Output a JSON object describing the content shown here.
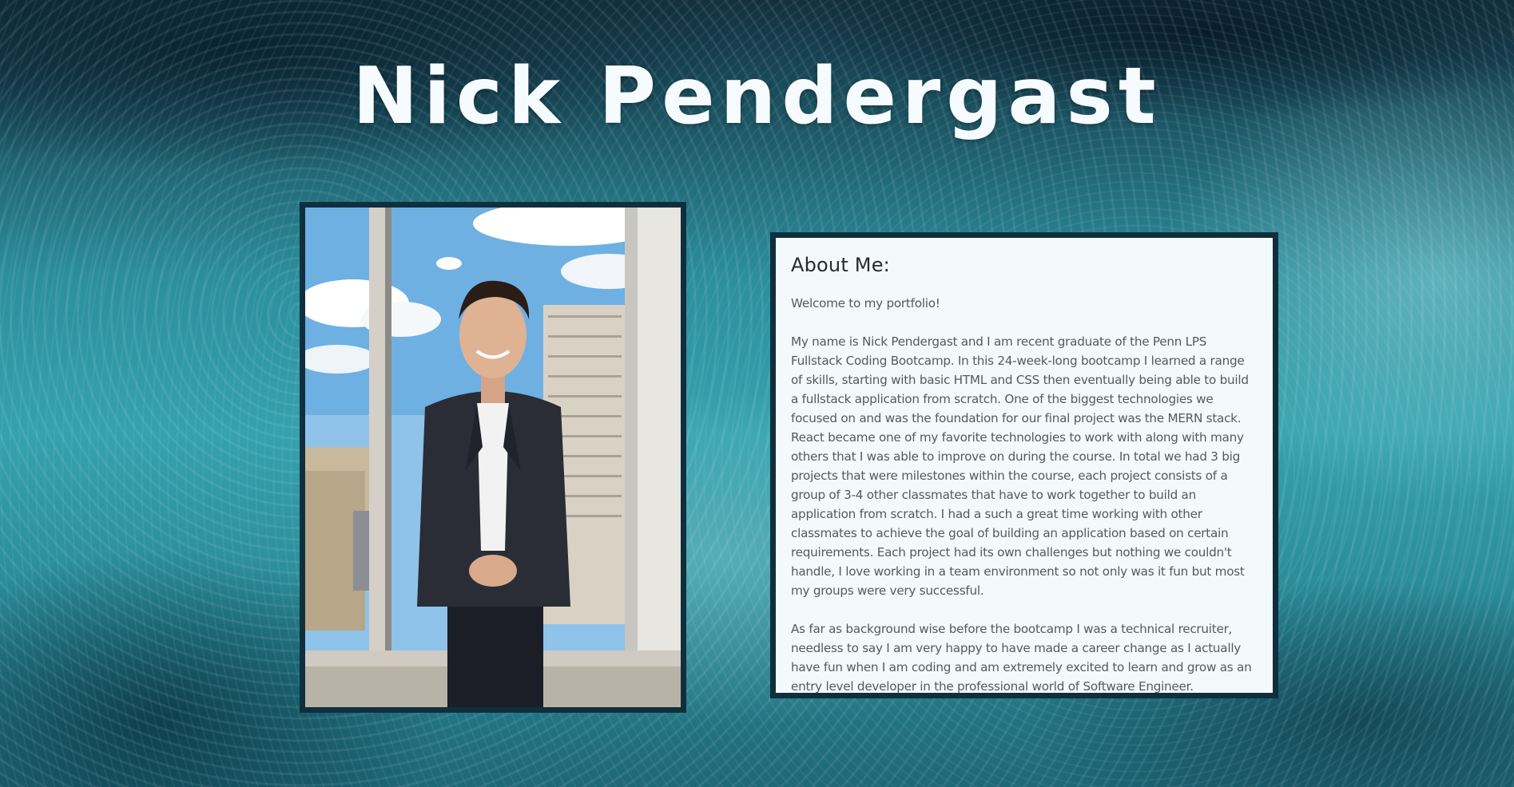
{
  "header": {
    "title": "Nick Pendergast"
  },
  "profile_photo": {
    "icon": "profile-photo"
  },
  "about": {
    "heading": "About Me:",
    "paragraphs": [
      "Welcome to my portfolio!",
      "My name is Nick Pendergast and I am recent graduate of the Penn LPS Fullstack Coding Bootcamp. In this 24-week-long bootcamp I learned a range of skills, starting with basic HTML and CSS then eventually being able to build a fullstack application from scratch. One of the biggest technologies we focused on and was the foundation for our final project was the MERN stack. React became one of my favorite technologies to work with along with many others that I was able to improve on during the course. In total we had 3 big projects that were milestones within the course, each project consists of a group of 3-4 other classmates that have to work together to build an application from scratch. I had a such a great time working with other classmates to achieve the goal of building an application based on certain requirements. Each project had its own challenges but nothing we couldn't handle, I love working in a team environment so not only was it fun but most my groups were very successful.",
      "As far as background wise before the bootcamp I was a technical recruiter, needless to say I am very happy to have made a career change as I actually have fun when I am coding and am extremely excited to learn and grow as an entry level developer in the professional world of Software Engineer."
    ]
  },
  "colors": {
    "frame_border": "#0f2f3d",
    "card_background": "#f4f9fb",
    "title_text": "#f6fbff"
  }
}
